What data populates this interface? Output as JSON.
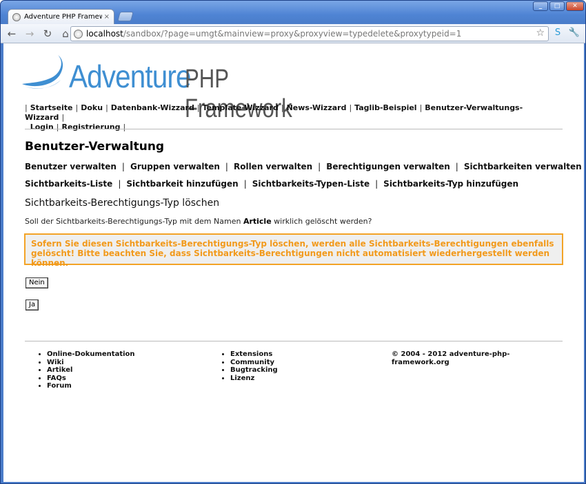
{
  "browser": {
    "tab_title": "Adventure PHP Framework sa",
    "tab_close": "×",
    "url_host": "localhost",
    "url_path": "/sandbox/?page=umgt&mainview=proxy&proxyview=typedelete&proxytypeid=1",
    "window_buttons": [
      "_",
      "□",
      "✕"
    ]
  },
  "logo": {
    "part1": "Adventure",
    "part2": "PHP Framework"
  },
  "main_nav": [
    "Startseite",
    "Doku",
    "Datenbank-Wizzard",
    "Template-Wizzard",
    "News-Wizzard",
    "Taglib-Beispiel",
    "Benutzer-Verwaltungs-Wizzard",
    "Login",
    "Registrierung"
  ],
  "page_title": "Benutzer-Verwaltung",
  "sub_nav_1": [
    "Benutzer verwalten",
    "Gruppen verwalten",
    "Rollen verwalten",
    "Berechtigungen verwalten",
    "Sichtbarkeiten verwalten"
  ],
  "sub_nav_2": [
    "Sichtbarkeits-Liste",
    "Sichtbarkeit hinzufügen",
    "Sichtbarkeits-Typen-Liste",
    "Sichtbarkeits-Typ hinzufügen"
  ],
  "section_title": "Sichtbarkeits-Berechtigungs-Typ löschen",
  "question": {
    "before": "Soll der Sichtbarkeits-Berechtigungs-Typ mit dem Namen ",
    "name": "Article",
    "after": " wirklich gelöscht werden?"
  },
  "warning": "Sofern Sie diesen Sichtbarkeits-Berechtigungs-Typ löschen, werden alle Sichtbarkeits-Berechtigungen ebenfalls gelöscht! Bitte beachten Sie, dass Sichtbarkeits-Berechtigungen nicht automatisiert wiederhergestellt werden können.",
  "buttons": {
    "no": "Nein",
    "yes": "Ja"
  },
  "footer": {
    "col1": [
      "Online-Dokumentation",
      "Wiki",
      "Artikel",
      "FAQs",
      "Forum"
    ],
    "col2": [
      "Extensions",
      "Community",
      "Bugtracking",
      "Lizenz"
    ],
    "copyright": "© 2004 - 2012 adventure-php-framework.org"
  },
  "colors": {
    "warning_border": "#f3a326",
    "warning_text": "#f29a1c",
    "logo_blue": "#3f8fd2"
  }
}
